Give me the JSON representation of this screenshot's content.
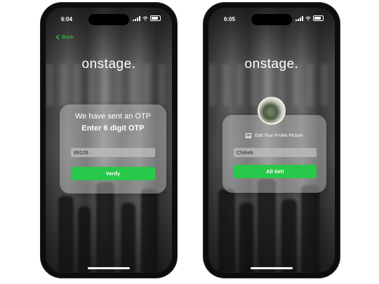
{
  "screen_otp": {
    "status_time": "6:04",
    "back_label": "Back",
    "logo_text": "onstage.",
    "line1": "We have sent an OTP",
    "line2": "Enter 6 digit OTP",
    "otp_value": "89126",
    "verify_label": "Verify"
  },
  "screen_profile": {
    "status_time": "6:05",
    "logo_text": "onstage.",
    "edit_label": "Edit Your Profile Picture",
    "name_value": "Chiheb",
    "submit_label": "All Set!"
  },
  "colors": {
    "accent_green": "#28c94a",
    "back_link_green": "#2ecc40"
  }
}
